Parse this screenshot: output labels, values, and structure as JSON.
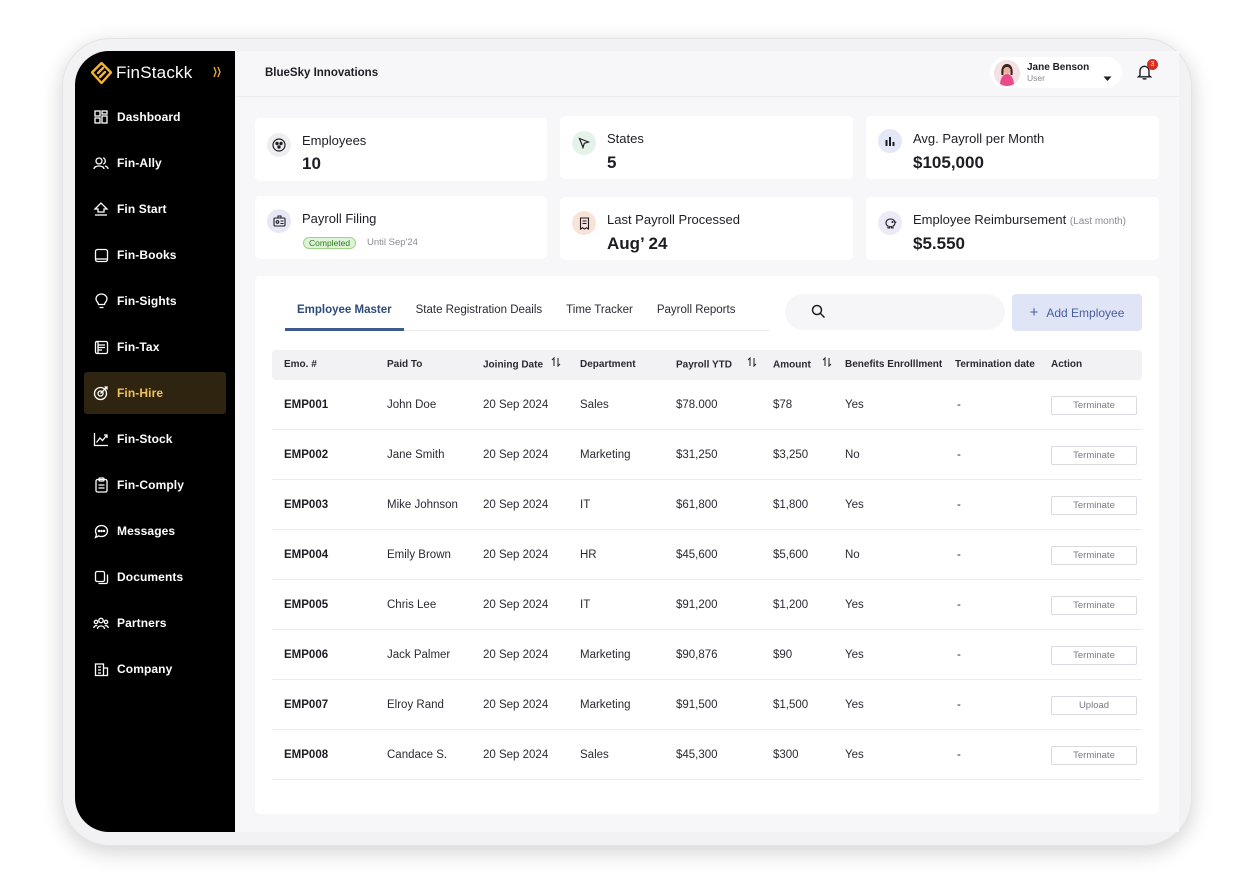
{
  "brand": {
    "name": "FinStackk",
    "accent": "#f2b431"
  },
  "sidebar": {
    "items": [
      {
        "label": "Dashboard",
        "icon": "grid-icon"
      },
      {
        "label": "Fin-Ally",
        "icon": "users-icon"
      },
      {
        "label": "Fin Start",
        "icon": "home-upload-icon"
      },
      {
        "label": "Fin-Books",
        "icon": "book-icon"
      },
      {
        "label": "Fin-Sights",
        "icon": "lightbulb-icon"
      },
      {
        "label": "Fin-Tax",
        "icon": "document-list-icon"
      },
      {
        "label": "Fin-Hire",
        "icon": "target-icon",
        "active": true
      },
      {
        "label": "Fin-Stock",
        "icon": "chart-line-icon"
      },
      {
        "label": "Fin-Comply",
        "icon": "clipboard-icon"
      },
      {
        "label": "Messages",
        "icon": "chat-icon"
      },
      {
        "label": "Documents",
        "icon": "documents-icon"
      },
      {
        "label": "Partners",
        "icon": "partners-icon"
      },
      {
        "label": "Company",
        "icon": "building-icon"
      }
    ]
  },
  "header": {
    "company": "BlueSky Innovations",
    "user": {
      "name": "Jane Benson",
      "role": "User"
    },
    "notifications": "3"
  },
  "stats": {
    "employees": {
      "label": "Employees",
      "value": "10"
    },
    "states": {
      "label": "States",
      "value": "5"
    },
    "avg_payroll": {
      "label": "Avg. Payroll per Month",
      "value": "$105,000"
    },
    "payroll_filing": {
      "label": "Payroll Filing",
      "status": "Completed",
      "until": "Until Sep'24"
    },
    "last_payroll": {
      "label": "Last Payroll Processed",
      "value": "Aug’ 24"
    },
    "reimbursement": {
      "label": "Employee Reimbursement",
      "note": "(Last month)",
      "value": "$5.550"
    }
  },
  "main": {
    "tabs": [
      "Employee Master",
      "State Registration Deails",
      "Time Tracker",
      "Payroll Reports"
    ],
    "active_tab": 0,
    "search": {
      "placeholder": "",
      "value": ""
    },
    "add_button": "Add Employee",
    "columns": [
      "Emo. #",
      "Paid To",
      "Joining Date",
      "Department",
      "Payroll YTD",
      "Amount",
      "Benefits Enrolllment",
      "Termination date",
      "Action"
    ],
    "rows": [
      {
        "id": "EMP001",
        "paid_to": "John Doe",
        "joining": "20 Sep 2024",
        "dept": "Sales",
        "ytd": "$78.000",
        "amount": "$78",
        "benefits": "Yes",
        "termination": "-",
        "action": "Terminate"
      },
      {
        "id": "EMP002",
        "paid_to": "Jane Smith",
        "joining": "20 Sep 2024",
        "dept": "Marketing",
        "ytd": "$31,250",
        "amount": "$3,250",
        "benefits": "No",
        "termination": "-",
        "action": "Terminate"
      },
      {
        "id": "EMP003",
        "paid_to": "Mike Johnson",
        "joining": "20 Sep 2024",
        "dept": "IT",
        "ytd": "$61,800",
        "amount": "$1,800",
        "benefits": "Yes",
        "termination": "-",
        "action": "Terminate"
      },
      {
        "id": "EMP004",
        "paid_to": "Emily Brown",
        "joining": "20 Sep 2024",
        "dept": "HR",
        "ytd": "$45,600",
        "amount": "$5,600",
        "benefits": "No",
        "termination": "-",
        "action": "Terminate"
      },
      {
        "id": "EMP005",
        "paid_to": "Chris Lee",
        "joining": "20 Sep 2024",
        "dept": "IT",
        "ytd": "$91,200",
        "amount": "$1,200",
        "benefits": "Yes",
        "termination": "-",
        "action": "Terminate"
      },
      {
        "id": "EMP006",
        "paid_to": "Jack Palmer",
        "joining": "20 Sep 2024",
        "dept": "Marketing",
        "ytd": "$90,876",
        "amount": "$90",
        "benefits": "Yes",
        "termination": "-",
        "action": "Terminate"
      },
      {
        "id": "EMP007",
        "paid_to": "Elroy Rand",
        "joining": "20 Sep 2024",
        "dept": "Marketing",
        "ytd": "$91,500",
        "amount": "$1,500",
        "benefits": "Yes",
        "termination": "-",
        "action": "Upload"
      },
      {
        "id": "EMP008",
        "paid_to": "Candace S.",
        "joining": "20 Sep 2024",
        "dept": "Sales",
        "ytd": "$45,300",
        "amount": "$300",
        "benefits": "Yes",
        "termination": "-",
        "action": "Terminate"
      }
    ]
  }
}
